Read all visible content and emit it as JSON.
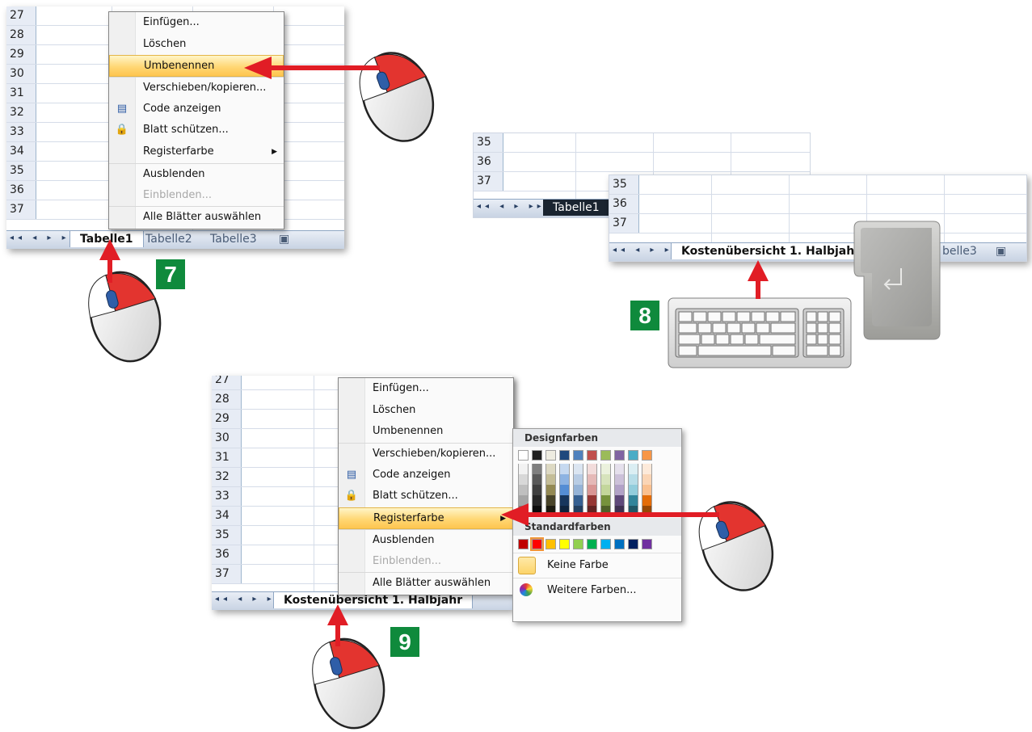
{
  "step7": {
    "row_numbers": [
      "27",
      "28",
      "29",
      "30",
      "31",
      "32",
      "33",
      "34",
      "35",
      "36",
      "37"
    ],
    "sheet_tabs": [
      "Tabelle1",
      "Tabelle2",
      "Tabelle3"
    ],
    "badge": "7",
    "menu": [
      {
        "label": "Einfügen...",
        "state": "normal"
      },
      {
        "label": "Löschen",
        "state": "normal"
      },
      {
        "label": "Umbenennen",
        "state": "highlighted"
      },
      {
        "label": "Verschieben/kopieren...",
        "state": "normal"
      },
      {
        "label": "Code anzeigen",
        "state": "normal",
        "icon": "code-icon"
      },
      {
        "label": "Blatt schützen...",
        "state": "normal",
        "icon": "lock-icon"
      },
      {
        "label": "Registerfarbe",
        "state": "submenu"
      },
      {
        "label": "Ausblenden",
        "state": "normal"
      },
      {
        "label": "Einblenden...",
        "state": "disabled"
      },
      {
        "label": "Alle Blätter auswählen",
        "state": "normal"
      }
    ]
  },
  "step8": {
    "back_row_numbers": [
      "35",
      "36",
      "37"
    ],
    "back_tab": "Tabelle1",
    "front_row_numbers": [
      "35",
      "36",
      "37"
    ],
    "front_tab": "Kostenübersicht 1. Halbjahr",
    "front_tab_other": "belle3",
    "badge": "8",
    "keyboard_icon": "keyboard-icon",
    "enter_key_icon": "enter-key-icon"
  },
  "step9": {
    "row_numbers": [
      "27",
      "28",
      "29",
      "30",
      "31",
      "32",
      "33",
      "34",
      "35",
      "36",
      "37"
    ],
    "sheet_tab": "Kostenübersicht 1. Halbjahr",
    "badge": "9",
    "menu": [
      {
        "label": "Einfügen...",
        "state": "normal"
      },
      {
        "label": "Löschen",
        "state": "normal"
      },
      {
        "label": "Umbenennen",
        "state": "normal"
      },
      {
        "label": "Verschieben/kopieren...",
        "state": "normal"
      },
      {
        "label": "Code anzeigen",
        "state": "normal",
        "icon": "code-icon"
      },
      {
        "label": "Blatt schützen...",
        "state": "normal",
        "icon": "lock-icon"
      },
      {
        "label": "Registerfarbe",
        "state": "highlighted"
      },
      {
        "label": "Ausblenden",
        "state": "normal"
      },
      {
        "label": "Einblenden...",
        "state": "disabled"
      },
      {
        "label": "Alle Blätter auswählen",
        "state": "normal"
      }
    ],
    "palette": {
      "design_title": "Designfarben",
      "standard_title": "Standardfarben",
      "design_top": [
        "#ffffff",
        "#1f1f1f",
        "#eeece1",
        "#1f497d",
        "#4f81bd",
        "#c0504d",
        "#9bbb59",
        "#8064a2",
        "#4bacc6",
        "#f79646"
      ],
      "design_shades": [
        [
          "#f2f2f2",
          "#7f7f7f",
          "#ddd9c3",
          "#c6d9f0",
          "#dbe5f1",
          "#f2dcdb",
          "#ebf1dd",
          "#e5e0ec",
          "#dbeef3",
          "#fdeada"
        ],
        [
          "#d8d8d8",
          "#595959",
          "#c4bd97",
          "#8db3e2",
          "#b8cce4",
          "#e5b9b7",
          "#d7e3bc",
          "#ccc1d9",
          "#b7dde8",
          "#fbd5b5"
        ],
        [
          "#bfbfbf",
          "#3f3f3f",
          "#938953",
          "#548dd4",
          "#95b3d7",
          "#d99694",
          "#c3d69b",
          "#b2a2c7",
          "#92cddc",
          "#fac08f"
        ],
        [
          "#a5a5a5",
          "#262626",
          "#494429",
          "#17365d",
          "#366092",
          "#953734",
          "#76923c",
          "#5f497a",
          "#31859b",
          "#e36c09"
        ],
        [
          "#7f7f7f",
          "#0c0c0c",
          "#1d1b10",
          "#0f243e",
          "#244061",
          "#632423",
          "#4f6128",
          "#3f3151",
          "#205867",
          "#974806"
        ]
      ],
      "standard": [
        "#c00000",
        "#ff0000",
        "#ffc000",
        "#ffff00",
        "#92d050",
        "#00b050",
        "#00b0f0",
        "#0070c0",
        "#002060",
        "#7030a0"
      ],
      "no_color": "Keine Farbe",
      "more_colors": "Weitere Farben..."
    }
  }
}
